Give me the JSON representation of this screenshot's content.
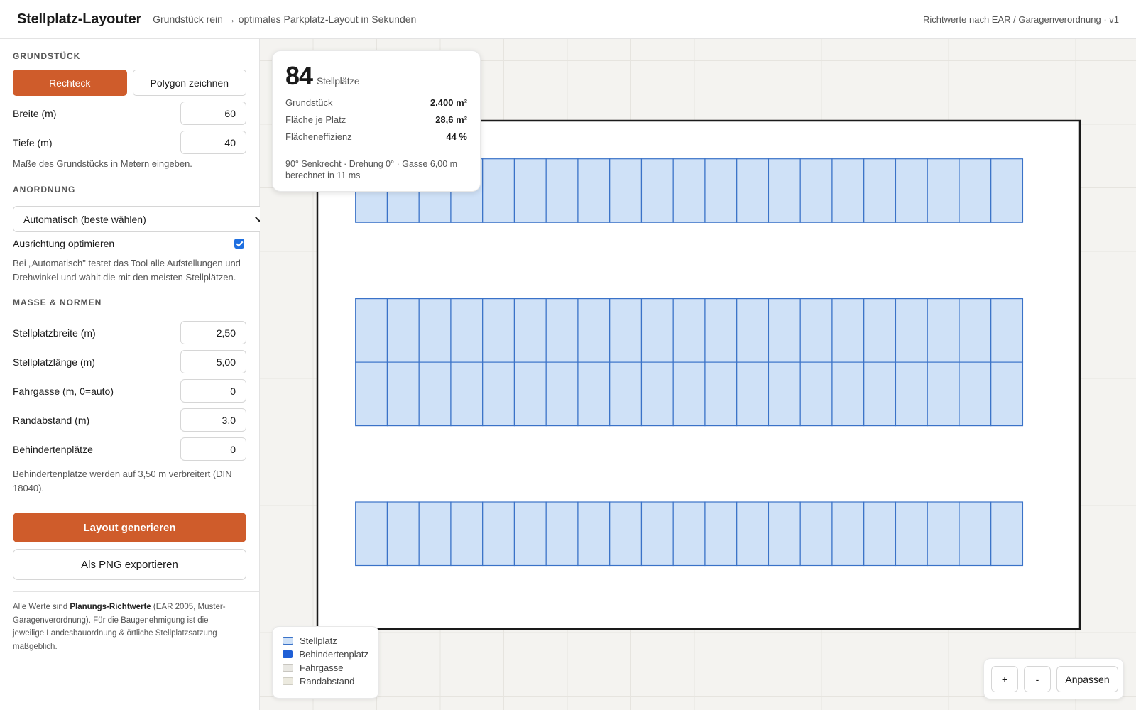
{
  "header": {
    "title": "Stellplatz-Layouter",
    "tagline": "Grundstück rein → optimales Parkplatz-Layout in Sekunden",
    "right_note": "Richtwerte nach EAR / Garagenverordnung · v1"
  },
  "sidebar": {
    "grundstueck": {
      "title": "Grundstück",
      "mode_rect": "Rechteck",
      "mode_polygon": "Polygon zeichnen",
      "active_mode": "Rechteck",
      "width_label": "Breite (m)",
      "width_value": "60",
      "depth_label": "Tiefe (m)",
      "depth_value": "40",
      "hint": "Maße des Grundstücks in Metern eingeben."
    },
    "anordnung": {
      "title": "Anordnung",
      "selected": "Automatisch (beste wählen)",
      "optimize_label": "Ausrichtung optimieren",
      "optimize_checked": true,
      "hint_line1": "Bei „Automatisch\" testet das Tool alle Aufstellungen und",
      "hint_line2": "Drehwinkel und wählt die mit den meisten Stellplätzen."
    },
    "masse": {
      "title": "Maße & Normen",
      "fields": [
        {
          "label": "Stellplatzbreite (m)",
          "value": "2,50"
        },
        {
          "label": "Stellplatzlänge (m)",
          "value": "5,00"
        },
        {
          "label": "Fahrgasse (m, 0=auto)",
          "value": "0"
        },
        {
          "label": "Randabstand (m)",
          "value": "3,0"
        },
        {
          "label": "Behindertenplätze",
          "value": "0"
        }
      ],
      "hint_line1": "Behindertenplätze werden auf 3,50 m verbreitert (DIN",
      "hint_line2": "18040)."
    },
    "generate_label": "Layout generieren",
    "export_label": "Als PNG exportieren",
    "disclaimer": {
      "l1a": "Alle Werte sind ",
      "l1b": "Planungs-Richtwerte",
      "l1c": " (EAR 2005, Muster-",
      "l2": "Garagenverordnung). Für die Baugenehmigung ist die",
      "l3": "jeweilige Landesbauordnung & örtliche Stellplatzsatzung",
      "l4": "maßgeblich."
    }
  },
  "stats": {
    "count": "84",
    "count_unit": "Stellplätze",
    "rows": [
      {
        "label": "Grundstück",
        "value": "2.400 m²"
      },
      {
        "label": "Fläche je Platz",
        "value": "28,6 m²"
      },
      {
        "label": "Flächeneffizienz",
        "value": "44 %"
      }
    ],
    "meta_line1": "90° Senkrecht · Drehung 0° · Gasse 6,00 m",
    "meta_line2": "berechnet in 11 ms"
  },
  "layout": {
    "lot_width_m": 60,
    "lot_depth_m": 40,
    "stall_width_m": 2.5,
    "stall_length_m": 5.0,
    "stalls_per_row": 21,
    "rows": [
      {
        "y_m": 3.0
      },
      {
        "y_m": 14.0
      },
      {
        "y_m": 19.0
      },
      {
        "y_m": 30.0
      }
    ],
    "colors": {
      "stall_fill": "#cfe1f7",
      "stall_stroke": "#3a72c8",
      "lot_stroke": "#1a1a1a"
    }
  },
  "legend": {
    "items": [
      {
        "label": "Stellplatz",
        "color": "#cfe1f7",
        "border": "#3a72c8"
      },
      {
        "label": "Behindertenplatz",
        "color": "#1f5fd6",
        "border": "#1f5fd6"
      },
      {
        "label": "Fahrgasse",
        "color": "#e9e8e3",
        "border": "#c8c6c0"
      },
      {
        "label": "Randabstand",
        "color": "#eceadf",
        "border": "#cfcdc3"
      }
    ]
  },
  "zoom": {
    "plus": "+",
    "minus": "-",
    "fit": "Anpassen"
  },
  "theme": {
    "accent": "#cf5c2b",
    "checkbox": "#1f6fe0"
  }
}
